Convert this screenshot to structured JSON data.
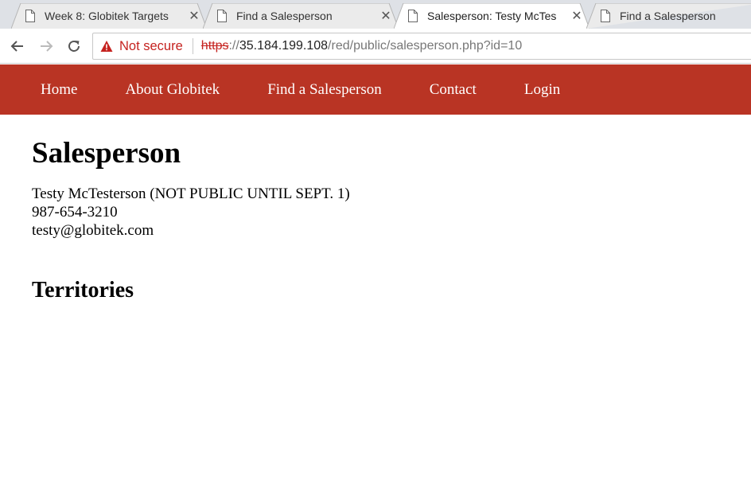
{
  "browser": {
    "tabs": [
      {
        "title": "Week 8: Globitek Targets",
        "active": false
      },
      {
        "title": "Find a Salesperson",
        "active": false
      },
      {
        "title": "Salesperson: Testy McTes",
        "active": true
      },
      {
        "title": "Find a Salesperson",
        "active": false
      }
    ],
    "close_glyph": "✕",
    "security_label": "Not secure",
    "url": {
      "scheme": "https",
      "separator": "://",
      "host": "35.184.199.108",
      "path": "/red/public/salesperson.php?id=10"
    },
    "colors": {
      "tabstrip": "#dee1e6",
      "warning": "#c5221f"
    }
  },
  "site": {
    "nav": [
      "Home",
      "About Globitek",
      "Find a Salesperson",
      "Contact",
      "Login"
    ],
    "nav_color": "#b93424"
  },
  "main": {
    "heading": "Salesperson",
    "name_line": "Testy McTesterson (NOT PUBLIC UNTIL SEPT. 1)",
    "phone": "987-654-3210",
    "email": "testy@globitek.com",
    "subheading": "Territories"
  },
  "icons": {
    "tab": "document-icon",
    "back": "back-arrow-icon",
    "forward": "forward-arrow-icon",
    "reload": "reload-icon",
    "security": "warning-triangle-icon"
  }
}
